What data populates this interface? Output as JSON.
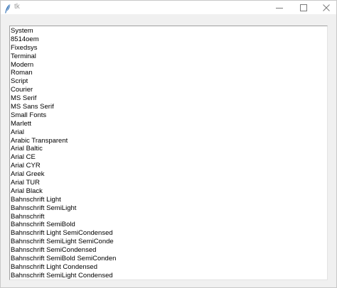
{
  "window": {
    "title": "tk",
    "buttons": {
      "minimize": "minimize-icon",
      "maximize": "maximize-icon",
      "close": "close-icon"
    }
  },
  "listbox": {
    "items": [
      "System",
      "8514oem",
      "Fixedsys",
      "Terminal",
      "Modern",
      "Roman",
      "Script",
      "Courier",
      "MS Serif",
      "MS Sans Serif",
      "Small Fonts",
      "Marlett",
      "Arial",
      "Arabic Transparent",
      "Arial Baltic",
      "Arial CE",
      "Arial CYR",
      "Arial Greek",
      "Arial TUR",
      "Arial Black",
      "Bahnschrift Light",
      "Bahnschrift SemiLight",
      "Bahnschrift",
      "Bahnschrift SemiBold",
      "Bahnschrift Light SemiCondensed",
      "Bahnschrift SemiLight SemiConde",
      "Bahnschrift SemiCondensed",
      "Bahnschrift SemiBold SemiConden",
      "Bahnschrift Light Condensed",
      "Bahnschrift SemiLight Condensed"
    ]
  }
}
